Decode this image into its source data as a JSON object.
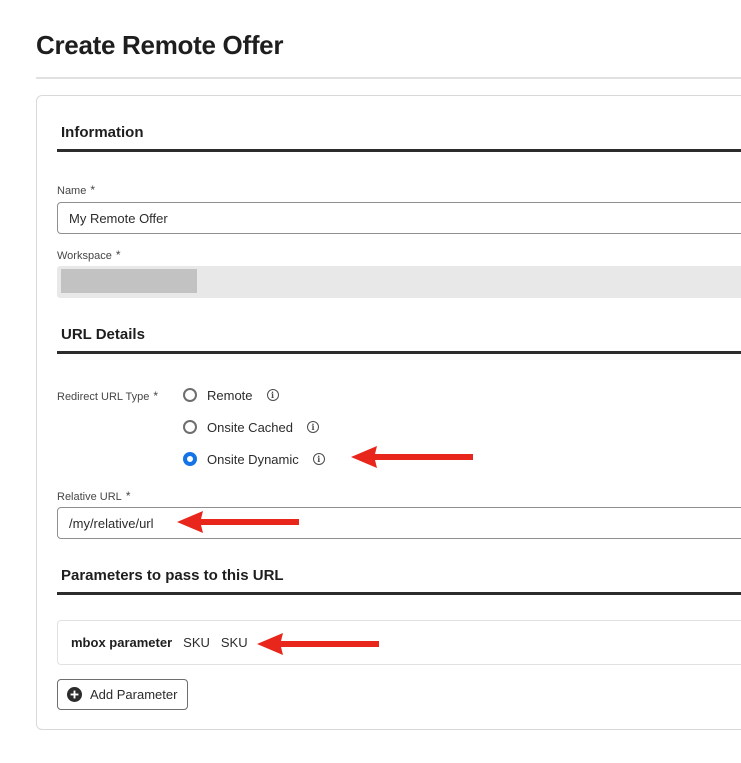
{
  "page": {
    "title": "Create Remote Offer"
  },
  "sections": {
    "information": "Information",
    "url_details": "URL Details",
    "parameters": "Parameters to pass to this URL"
  },
  "fields": {
    "name": {
      "label": "Name",
      "required_mark": "*",
      "value": "My Remote Offer"
    },
    "workspace": {
      "label": "Workspace",
      "required_mark": "*"
    },
    "redirect_url_type": {
      "label": "Redirect URL Type",
      "required_mark": "*",
      "options": [
        {
          "label": "Remote",
          "selected": false
        },
        {
          "label": "Onsite Cached",
          "selected": false
        },
        {
          "label": "Onsite Dynamic",
          "selected": true
        }
      ]
    },
    "relative_url": {
      "label": "Relative URL",
      "required_mark": "*",
      "value": "/my/relative/url"
    }
  },
  "parameters": [
    {
      "key": "mbox parameter",
      "values": [
        "SKU",
        "SKU"
      ]
    }
  ],
  "buttons": {
    "add_parameter": "Add Parameter"
  },
  "icons": {
    "info": "info-circle-icon",
    "add": "add-circle-icon",
    "annotation": "red-arrow-icon"
  },
  "colors": {
    "accent": "#1473e6",
    "annotation_arrow": "#e8261b"
  }
}
